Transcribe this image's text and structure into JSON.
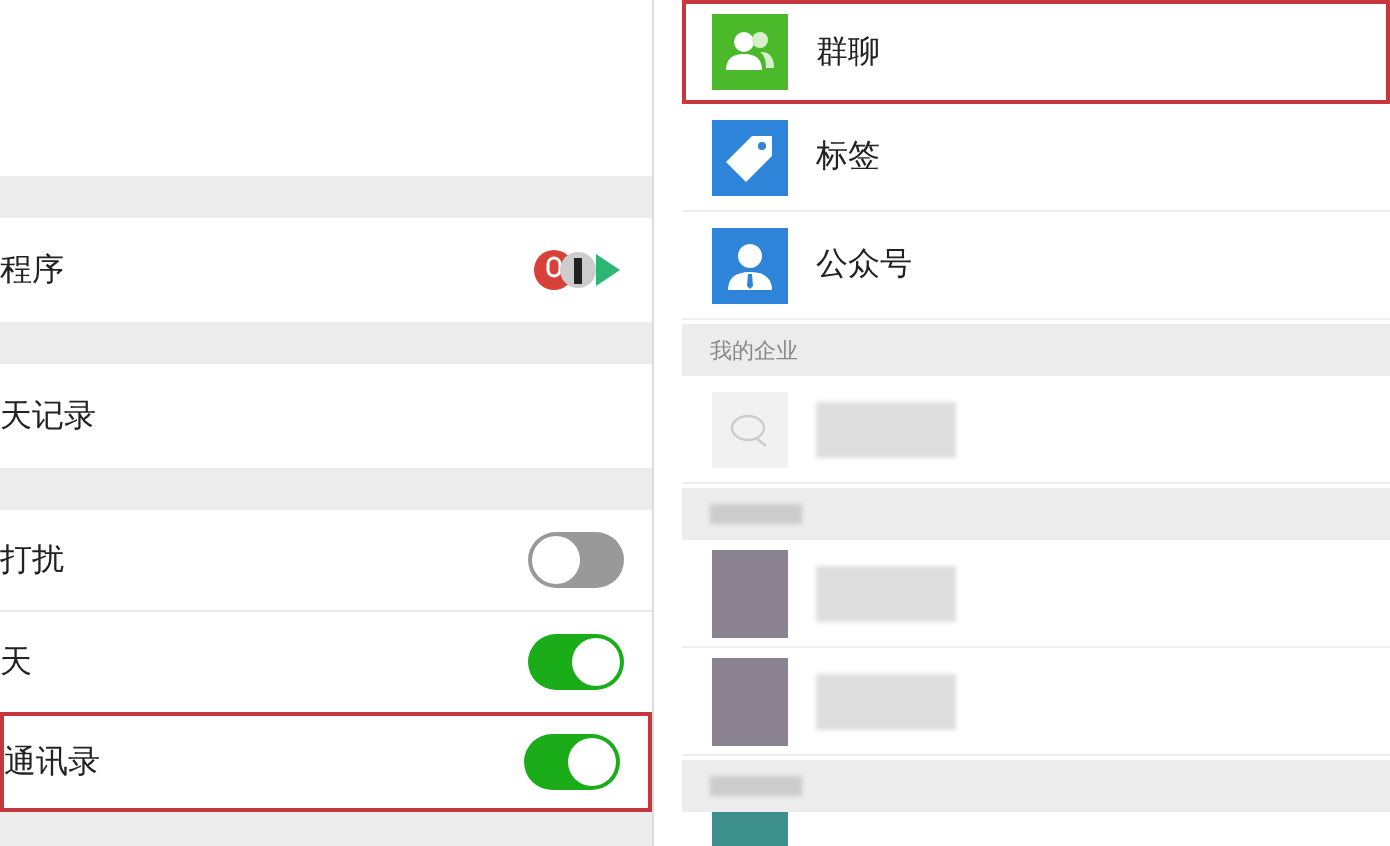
{
  "settings_panel": {
    "groups": [
      {
        "rows": [
          {
            "kind": "apps_link",
            "label": "程序",
            "highlighted": false
          }
        ]
      },
      {
        "rows": [
          {
            "kind": "link",
            "label": "天记录",
            "highlighted": false
          }
        ]
      },
      {
        "rows": [
          {
            "kind": "toggle",
            "label": "打扰",
            "on": false,
            "highlighted": false
          },
          {
            "kind": "toggle",
            "label": "天",
            "on": true,
            "highlighted": false
          },
          {
            "kind": "toggle",
            "label": "通讯录",
            "on": true,
            "highlighted": true
          }
        ]
      }
    ]
  },
  "contacts_panel": {
    "sections": [
      {
        "items": [
          {
            "kind": "feature",
            "label": "群聊",
            "highlighted": true
          },
          {
            "kind": "feature",
            "label": "标签",
            "highlighted": false
          },
          {
            "kind": "feature",
            "label": "公众号",
            "highlighted": false
          }
        ]
      },
      {
        "header": "我的企业",
        "items": [
          {
            "kind": "enterprise",
            "highlighted": false
          }
        ]
      },
      {
        "items": [
          {
            "kind": "contact",
            "highlighted": false
          },
          {
            "kind": "contact",
            "highlighted": false
          }
        ]
      },
      {
        "items": [
          {
            "kind": "partial_contact",
            "highlighted": false
          }
        ]
      }
    ]
  }
}
